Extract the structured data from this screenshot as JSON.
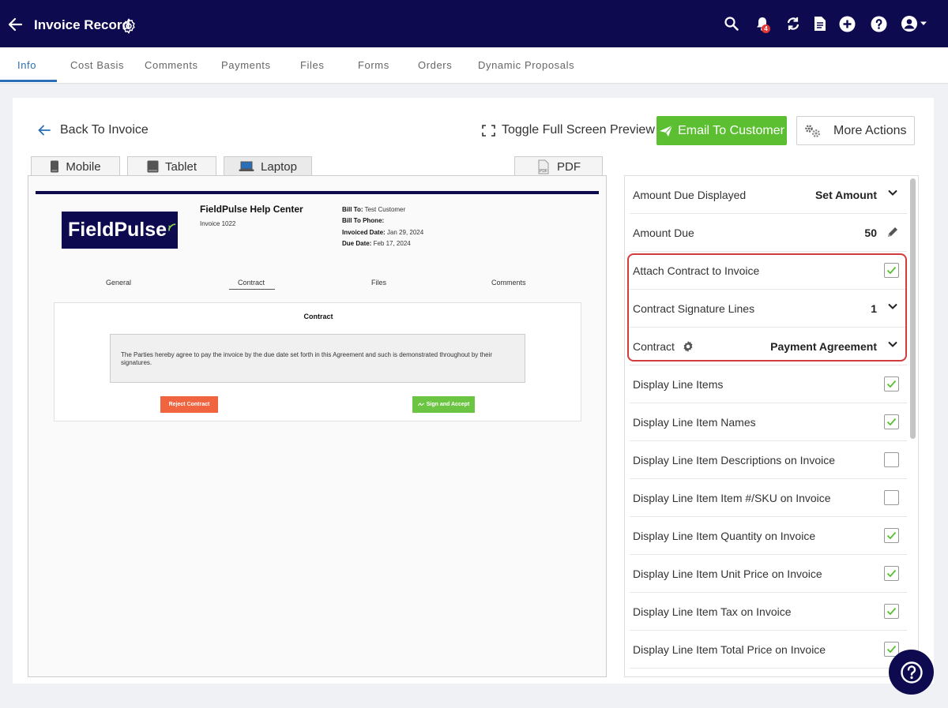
{
  "header": {
    "title": "Invoice Record",
    "notification_count": "4"
  },
  "tabs": [
    "Info",
    "Cost Basis",
    "Comments",
    "Payments",
    "Files",
    "Forms",
    "Orders",
    "Dynamic Proposals"
  ],
  "toolbar": {
    "back_label": "Back To Invoice",
    "toggle_label": "Toggle Full Screen Preview",
    "email_label": "Email To Customer",
    "more_label": "More Actions"
  },
  "devices": {
    "mobile": "Mobile",
    "tablet": "Tablet",
    "laptop": "Laptop",
    "pdf": "PDF",
    "pdf_icon_text": "PDF"
  },
  "preview": {
    "logo_text": "FieldPulse",
    "company": "FieldPulse Help Center",
    "invoice_no": "Invoice 1022",
    "bill_to_label": "Bill To:",
    "bill_to_value": "Test Customer",
    "bill_phone_label": "Bill To Phone:",
    "invoiced_date_label": "Invoiced Date:",
    "invoiced_date_value": "Jan 29, 2024",
    "due_date_label": "Due Date:",
    "due_date_value": "Feb 17, 2024",
    "subtabs": [
      "General",
      "Contract",
      "Files",
      "Comments"
    ],
    "contract_title": "Contract",
    "contract_text": "The Parties hereby agree to pay the invoice by the due date set forth in this Agreement and such is demonstrated throughout by their signatures.",
    "reject_label": "Reject Contract",
    "sign_label": "Sign and Accept"
  },
  "settings": {
    "amount_due_displayed": {
      "label": "Amount Due Displayed",
      "value": "Set Amount"
    },
    "amount_due": {
      "label": "Amount Due",
      "value": "50"
    },
    "attach_contract": {
      "label": "Attach Contract to Invoice",
      "checked": true
    },
    "signature_lines": {
      "label": "Contract Signature Lines",
      "value": "1"
    },
    "contract": {
      "label": "Contract",
      "value": "Payment Agreement"
    },
    "checkboxes": [
      {
        "label": "Display Line Items",
        "checked": true
      },
      {
        "label": "Display Line Item Names",
        "checked": true
      },
      {
        "label": "Display Line Item Descriptions on Invoice",
        "checked": false
      },
      {
        "label": "Display Line Item Item #/SKU on Invoice",
        "checked": false
      },
      {
        "label": "Display Line Item Quantity on Invoice",
        "checked": true
      },
      {
        "label": "Display Line Item Unit Price on Invoice",
        "checked": true
      },
      {
        "label": "Display Line Item Tax on Invoice",
        "checked": true
      },
      {
        "label": "Display Line Item Total Price on Invoice",
        "checked": true
      }
    ]
  },
  "colors": {
    "navy": "#0d0a4f",
    "accent_blue": "#2a6fb8",
    "green": "#5cbf32",
    "highlight_red": "#d23c3c"
  }
}
